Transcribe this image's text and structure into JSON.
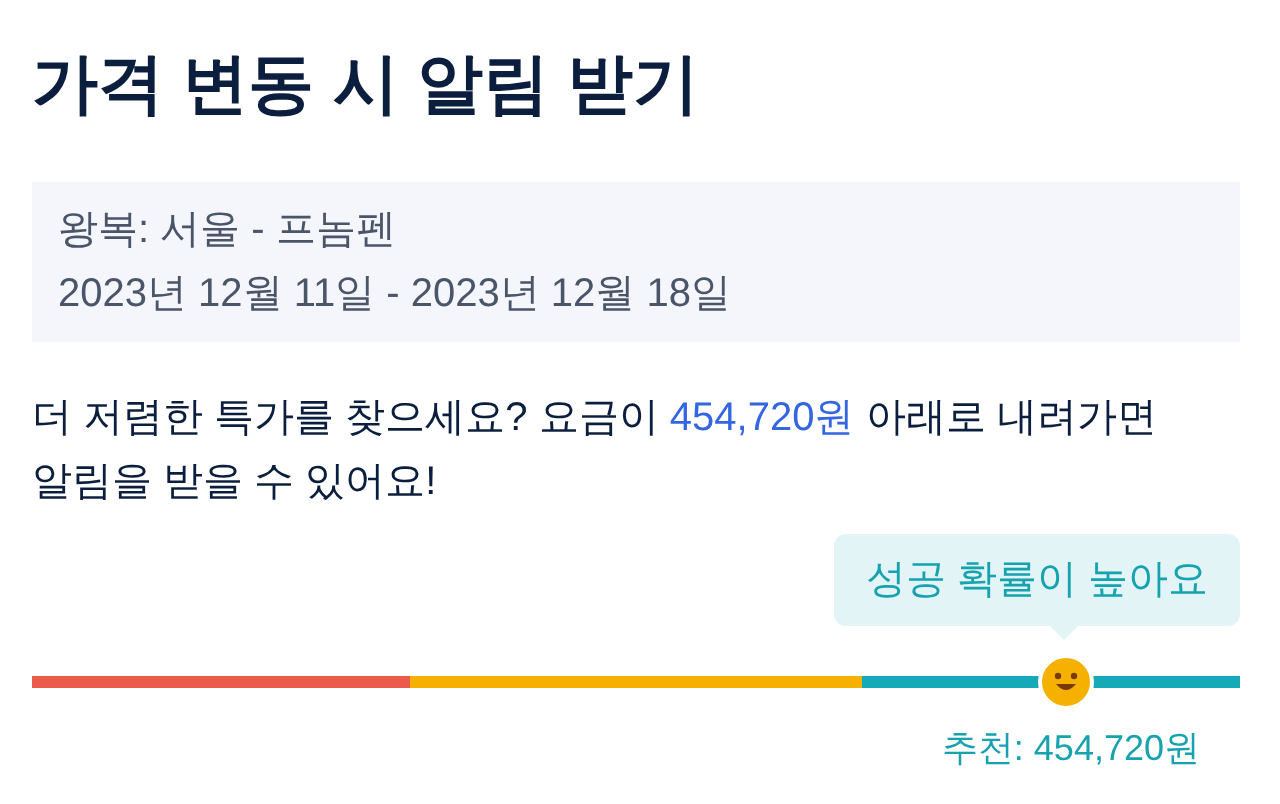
{
  "title": "가격 변동 시 알림 받기",
  "trip": {
    "route": "왕복: 서울 - 프놈펜",
    "dates": "2023년 12월 11일 - 2023년 12월 18일"
  },
  "message": {
    "before": "더 저렴한 특가를 찾으세요? 요금이 ",
    "amount": "454,720원",
    "after": " 아래로 내려가면 알림을 받을 수 있어요!"
  },
  "tooltip": "성공 확률이 높아요",
  "slider": {
    "level": 0.856,
    "segments": [
      {
        "color": "#ec5a4b"
      },
      {
        "color": "#f6b100"
      },
      {
        "color": "#16a9b7"
      }
    ]
  },
  "recommendation": "추천: 454,720원"
}
